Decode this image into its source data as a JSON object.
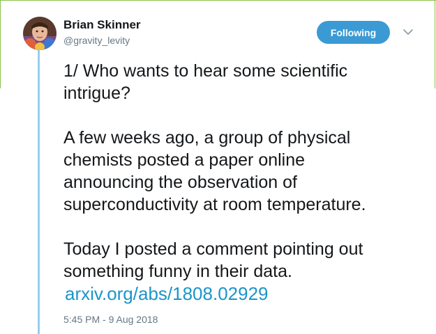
{
  "author": {
    "name": "Brian Skinner",
    "handle": "@gravity_levity"
  },
  "follow_button": {
    "label": "Following"
  },
  "icons": {
    "avatar": "profile-photo",
    "menu": "chevron-down-icon"
  },
  "tweet": {
    "lines": [
      "1/  Who wants to hear some scientific",
      "intrigue?",
      "A few weeks ago, a group of physical",
      "chemists posted a paper online",
      "announcing the observation of",
      "superconductivity at room temperature.",
      "Today I posted a comment pointing out",
      "something funny in their data."
    ],
    "link": "arxiv.org/abs/1808.02929",
    "timestamp": "5:45 PM - 9 Aug 2018"
  },
  "colors": {
    "button_bg": "#3b9ad3",
    "link": "#1b95c9",
    "thread_line": "#95cff0",
    "frame": "#8bc34a"
  }
}
